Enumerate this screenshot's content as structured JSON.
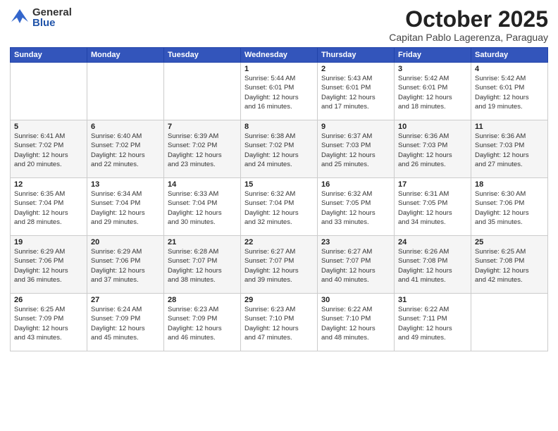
{
  "logo": {
    "general": "General",
    "blue": "Blue"
  },
  "header": {
    "month": "October 2025",
    "location": "Capitan Pablo Lagerenza, Paraguay"
  },
  "weekdays": [
    "Sunday",
    "Monday",
    "Tuesday",
    "Wednesday",
    "Thursday",
    "Friday",
    "Saturday"
  ],
  "weeks": [
    [
      {
        "day": "",
        "info": ""
      },
      {
        "day": "",
        "info": ""
      },
      {
        "day": "",
        "info": ""
      },
      {
        "day": "1",
        "info": "Sunrise: 5:44 AM\nSunset: 6:01 PM\nDaylight: 12 hours\nand 16 minutes."
      },
      {
        "day": "2",
        "info": "Sunrise: 5:43 AM\nSunset: 6:01 PM\nDaylight: 12 hours\nand 17 minutes."
      },
      {
        "day": "3",
        "info": "Sunrise: 5:42 AM\nSunset: 6:01 PM\nDaylight: 12 hours\nand 18 minutes."
      },
      {
        "day": "4",
        "info": "Sunrise: 5:42 AM\nSunset: 6:01 PM\nDaylight: 12 hours\nand 19 minutes."
      }
    ],
    [
      {
        "day": "5",
        "info": "Sunrise: 6:41 AM\nSunset: 7:02 PM\nDaylight: 12 hours\nand 20 minutes."
      },
      {
        "day": "6",
        "info": "Sunrise: 6:40 AM\nSunset: 7:02 PM\nDaylight: 12 hours\nand 22 minutes."
      },
      {
        "day": "7",
        "info": "Sunrise: 6:39 AM\nSunset: 7:02 PM\nDaylight: 12 hours\nand 23 minutes."
      },
      {
        "day": "8",
        "info": "Sunrise: 6:38 AM\nSunset: 7:02 PM\nDaylight: 12 hours\nand 24 minutes."
      },
      {
        "day": "9",
        "info": "Sunrise: 6:37 AM\nSunset: 7:03 PM\nDaylight: 12 hours\nand 25 minutes."
      },
      {
        "day": "10",
        "info": "Sunrise: 6:36 AM\nSunset: 7:03 PM\nDaylight: 12 hours\nand 26 minutes."
      },
      {
        "day": "11",
        "info": "Sunrise: 6:36 AM\nSunset: 7:03 PM\nDaylight: 12 hours\nand 27 minutes."
      }
    ],
    [
      {
        "day": "12",
        "info": "Sunrise: 6:35 AM\nSunset: 7:04 PM\nDaylight: 12 hours\nand 28 minutes."
      },
      {
        "day": "13",
        "info": "Sunrise: 6:34 AM\nSunset: 7:04 PM\nDaylight: 12 hours\nand 29 minutes."
      },
      {
        "day": "14",
        "info": "Sunrise: 6:33 AM\nSunset: 7:04 PM\nDaylight: 12 hours\nand 30 minutes."
      },
      {
        "day": "15",
        "info": "Sunrise: 6:32 AM\nSunset: 7:04 PM\nDaylight: 12 hours\nand 32 minutes."
      },
      {
        "day": "16",
        "info": "Sunrise: 6:32 AM\nSunset: 7:05 PM\nDaylight: 12 hours\nand 33 minutes."
      },
      {
        "day": "17",
        "info": "Sunrise: 6:31 AM\nSunset: 7:05 PM\nDaylight: 12 hours\nand 34 minutes."
      },
      {
        "day": "18",
        "info": "Sunrise: 6:30 AM\nSunset: 7:06 PM\nDaylight: 12 hours\nand 35 minutes."
      }
    ],
    [
      {
        "day": "19",
        "info": "Sunrise: 6:29 AM\nSunset: 7:06 PM\nDaylight: 12 hours\nand 36 minutes."
      },
      {
        "day": "20",
        "info": "Sunrise: 6:29 AM\nSunset: 7:06 PM\nDaylight: 12 hours\nand 37 minutes."
      },
      {
        "day": "21",
        "info": "Sunrise: 6:28 AM\nSunset: 7:07 PM\nDaylight: 12 hours\nand 38 minutes."
      },
      {
        "day": "22",
        "info": "Sunrise: 6:27 AM\nSunset: 7:07 PM\nDaylight: 12 hours\nand 39 minutes."
      },
      {
        "day": "23",
        "info": "Sunrise: 6:27 AM\nSunset: 7:07 PM\nDaylight: 12 hours\nand 40 minutes."
      },
      {
        "day": "24",
        "info": "Sunrise: 6:26 AM\nSunset: 7:08 PM\nDaylight: 12 hours\nand 41 minutes."
      },
      {
        "day": "25",
        "info": "Sunrise: 6:25 AM\nSunset: 7:08 PM\nDaylight: 12 hours\nand 42 minutes."
      }
    ],
    [
      {
        "day": "26",
        "info": "Sunrise: 6:25 AM\nSunset: 7:09 PM\nDaylight: 12 hours\nand 43 minutes."
      },
      {
        "day": "27",
        "info": "Sunrise: 6:24 AM\nSunset: 7:09 PM\nDaylight: 12 hours\nand 45 minutes."
      },
      {
        "day": "28",
        "info": "Sunrise: 6:23 AM\nSunset: 7:09 PM\nDaylight: 12 hours\nand 46 minutes."
      },
      {
        "day": "29",
        "info": "Sunrise: 6:23 AM\nSunset: 7:10 PM\nDaylight: 12 hours\nand 47 minutes."
      },
      {
        "day": "30",
        "info": "Sunrise: 6:22 AM\nSunset: 7:10 PM\nDaylight: 12 hours\nand 48 minutes."
      },
      {
        "day": "31",
        "info": "Sunrise: 6:22 AM\nSunset: 7:11 PM\nDaylight: 12 hours\nand 49 minutes."
      },
      {
        "day": "",
        "info": ""
      }
    ]
  ]
}
